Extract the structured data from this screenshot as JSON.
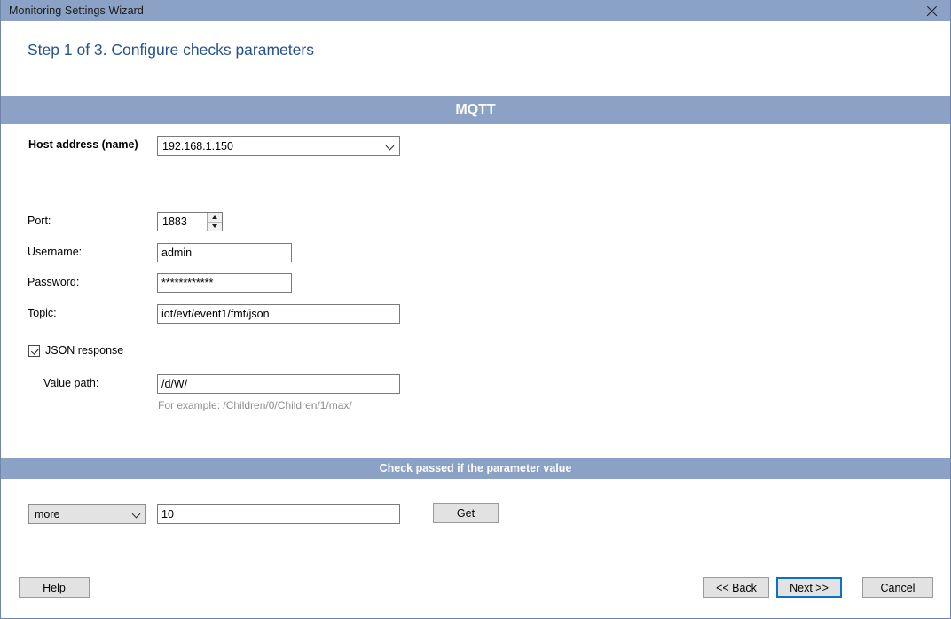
{
  "window": {
    "title": "Monitoring Settings Wizard",
    "close_icon": "close-icon"
  },
  "step": {
    "title": "Step 1 of 3. Configure checks parameters"
  },
  "sections": {
    "protocol_band": "MQTT",
    "check_band": "Check passed if the parameter value"
  },
  "form": {
    "host": {
      "label": "Host address (name)",
      "value": "192.168.1.150",
      "placeholder": "",
      "arrow_icon": "chevron-down-icon"
    },
    "port": {
      "label": "Port:",
      "value": "1883",
      "up_icon": "spinner-up-icon",
      "down_icon": "spinner-down-icon"
    },
    "username": {
      "label": "Username:",
      "value": "admin",
      "placeholder": ""
    },
    "password": {
      "label": "Password:",
      "value": "************",
      "placeholder": ""
    },
    "topic": {
      "label": "Topic:",
      "value": "iot/evt/event1/fmt/json",
      "placeholder": ""
    },
    "json_response": {
      "label": "JSON response",
      "checked": true
    },
    "value_path": {
      "label": "Value path:",
      "value": "/d/W/",
      "placeholder": "",
      "hint": "For example: /Children/0/Children/1/max/"
    }
  },
  "condition": {
    "operator": {
      "value": "more",
      "arrow_icon": "chevron-down-icon"
    },
    "threshold": {
      "value": "10",
      "placeholder": ""
    },
    "get_button": "Get"
  },
  "footer": {
    "help": "Help",
    "back": "<< Back",
    "next": "Next >>",
    "cancel": "Cancel"
  },
  "colors": {
    "band": "#8ba2c6",
    "title_bar": "#8ba2c6",
    "step_title": "#29528c",
    "focus_border": "#0a72c4",
    "hint_text": "#8d8d8d"
  }
}
